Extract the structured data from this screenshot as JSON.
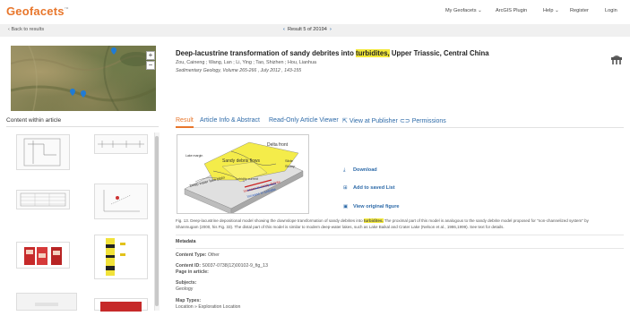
{
  "brand": {
    "logo": "Geofacets",
    "tm": "™",
    "accent": "#e8762b",
    "link": "#2d6aa8"
  },
  "topnav": {
    "my_geofacets": "My Geofacets",
    "arcgis": "ArcGIS Plugin",
    "help": "Help",
    "register": "Register",
    "login": "Login"
  },
  "subbar": {
    "back": "Back to results",
    "result_counter": "Result 5 of 20194"
  },
  "map": {
    "zoom_in": "+",
    "zoom_out": "−"
  },
  "content_within": {
    "title": "Content within article"
  },
  "article": {
    "title_before": "Deep-lacustrine transformation of sandy debrites into ",
    "title_highlight": "turbidites,",
    "title_after": " Upper Triassic, Central China",
    "authors": "Zou, Caineng ; Wang, Lan ; Li, Ying ; Tao, Shizhen ; Hou, Lianhua",
    "journal": "Sedimentary Geology, Volume 265-266 , July 2012 , 143-155"
  },
  "tabs": [
    {
      "label": "Result"
    },
    {
      "label": "Article Info & Abstract"
    },
    {
      "label": "Read-Only Article Viewer"
    },
    {
      "label": "View at Publisher"
    },
    {
      "label": "Permissions"
    }
  ],
  "figure_labels": {
    "delta_front": "Delta front",
    "lake_margin": "Lake margin",
    "sandy_debris_flows": "Sandy debris flows",
    "slide": "Slide",
    "slump": "Slump",
    "deep_water_lake_plain": "Deep water lake plain",
    "turbidity_current": "Turbidity current",
    "inc_sandy": "Increase in sandy debrite",
    "inc_turb": "Increase in turbidite"
  },
  "actions": {
    "download": "Download",
    "add_saved": "Add to saved List",
    "view_original": "View original figure"
  },
  "caption": {
    "line1_before": "Fig. 13. Deep-lacustrine depositional model showing the downslope transformation of sandy debrites into ",
    "line1_highlight": "turbidites.",
    "line1_after": " The proximal part of this model is analogous to the sandy debrite model proposed for \"non-channelized system\" by",
    "line2": "Shanmugam (2000, his Fig. 33). The distal part of this model is similar to modern deep-water lakes, such as Lake Baikal and Crater Lake (Nelson et al., 1986,1999). See text for details."
  },
  "metadata": {
    "heading": "Metadata",
    "content_type_label": "Content Type:",
    "content_type_value": "Other",
    "content_id_label": "Content ID:",
    "content_id_value": "S0037-0738(12)00102-9_fig_13",
    "page_label": "Page in article:",
    "subjects_label": "Subjects:",
    "subjects_value": "Geology",
    "map_types_label": "Map Types:",
    "map_types_value": "Location » Exploration Location"
  }
}
